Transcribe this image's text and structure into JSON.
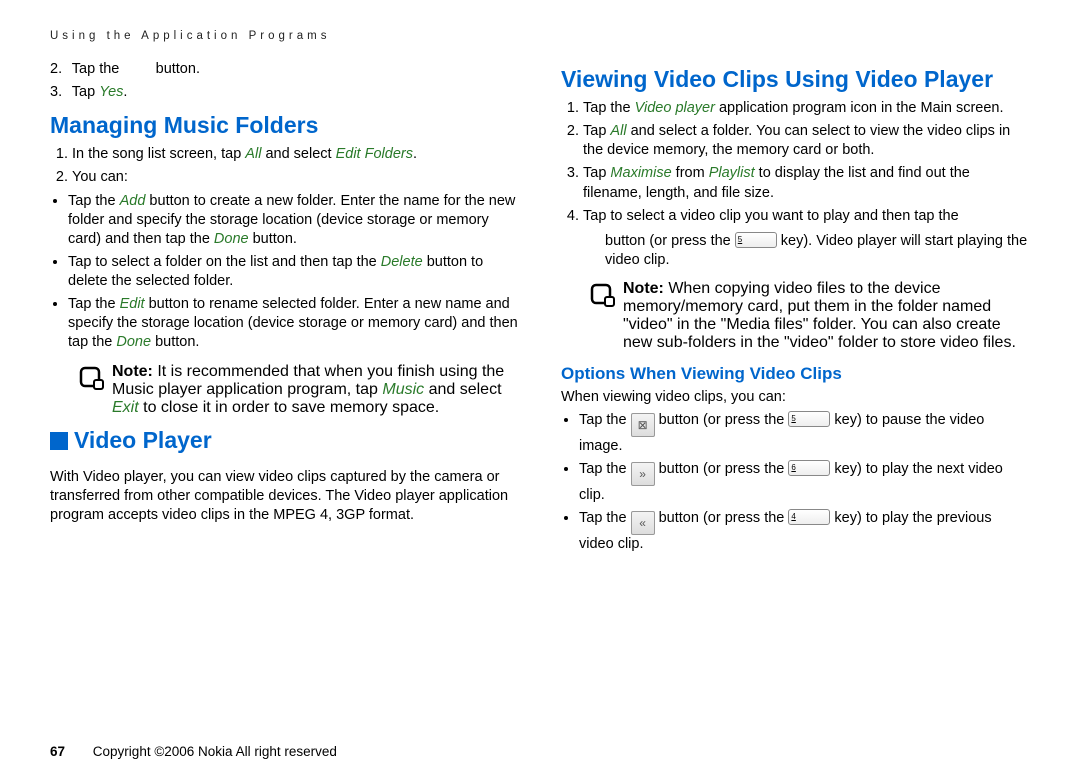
{
  "runningHead": "Using the Application Programs",
  "col1": {
    "step2_pre": "Tap the",
    "step2_post": "button.",
    "step3_pre": "Tap ",
    "step3_ui": "Yes",
    "step3_post": ".",
    "h_manage": "Managing Music Folders",
    "mf1_a": "In the song list screen, tap ",
    "mf1_ui1": "All",
    "mf1_b": " and select ",
    "mf1_ui2": "Edit Folders",
    "mf1_c": ".",
    "mf2": "You can:",
    "b1_a": "Tap the ",
    "b1_ui1": "Add",
    "b1_b": " button to create a new folder. Enter the name for the new folder and specify the storage location (device storage or memory card) and then tap the ",
    "b1_ui2": "Done",
    "b1_c": " button.",
    "b2_a": "Tap to select a folder on the list and then tap the ",
    "b2_ui1": "Delete",
    "b2_b": " button to delete the selected folder.",
    "b3_a": "Tap the ",
    "b3_ui1": "Edit",
    "b3_b": " button to rename selected folder. Enter a new name and specify the storage location (device storage or memory card) and then tap the ",
    "b3_ui2": "Done",
    "b3_c": " button.",
    "note_label": "Note: ",
    "note_a": "It is recommended that when you finish using the Music player application program, tap ",
    "note_ui1": "Music",
    "note_b": " and select ",
    "note_ui2": "Exit",
    "note_c": " to close it in order to save memory space.",
    "h_video": "Video Player",
    "vp_body": "With Video player, you can view video clips captured by the camera or transferred from other compatible devices. The Video player application program accepts video clips in the MPEG 4, 3GP format."
  },
  "col2": {
    "h_view": "Viewing Video Clips Using Video Player",
    "v1_a": "Tap the ",
    "v1_ui1": "Video player",
    "v1_b": " application program icon in the Main screen.",
    "v2_a": "Tap ",
    "v2_ui1": "All",
    "v2_b": " and select a folder. You can select to view the video clips in the device memory, the memory card or both.",
    "v3_a": "Tap ",
    "v3_ui1": "Maximise",
    "v3_b": " from ",
    "v3_ui2": "Playlist",
    "v3_c": " to display the list and find out the filename, length, and file size.",
    "v4_a": "Tap to select a video clip you want to play and then tap the",
    "v4_sub_a": "button (or press the ",
    "v4_sub_b": " key). Video player will start playing the video clip.",
    "note_label": "Note: ",
    "note_body": "When copying video files to the device memory/memory card, put them in the folder named \"video\" in the \"Media files\" folder. You can also create new sub-folders in the \"video\" folder to store video files.",
    "h_options": "Options When Viewing Video Clips",
    "opt_intro": "When viewing video clips, you can:",
    "o1_a": "Tap the ",
    "o1_b": " button (or press the ",
    "o1_c": " key) to pause the video image.",
    "o2_a": "Tap the ",
    "o2_b": " button (or press the ",
    "o2_c": " key) to play the next video clip.",
    "o3_a": "Tap the ",
    "o3_b": " button (or press the ",
    "o3_c": " key) to play the previous video clip.",
    "key5": "5",
    "key6": "6",
    "key4": "4"
  },
  "footer": {
    "page": "67",
    "copyright": "Copyright ©2006 Nokia All right reserved"
  }
}
